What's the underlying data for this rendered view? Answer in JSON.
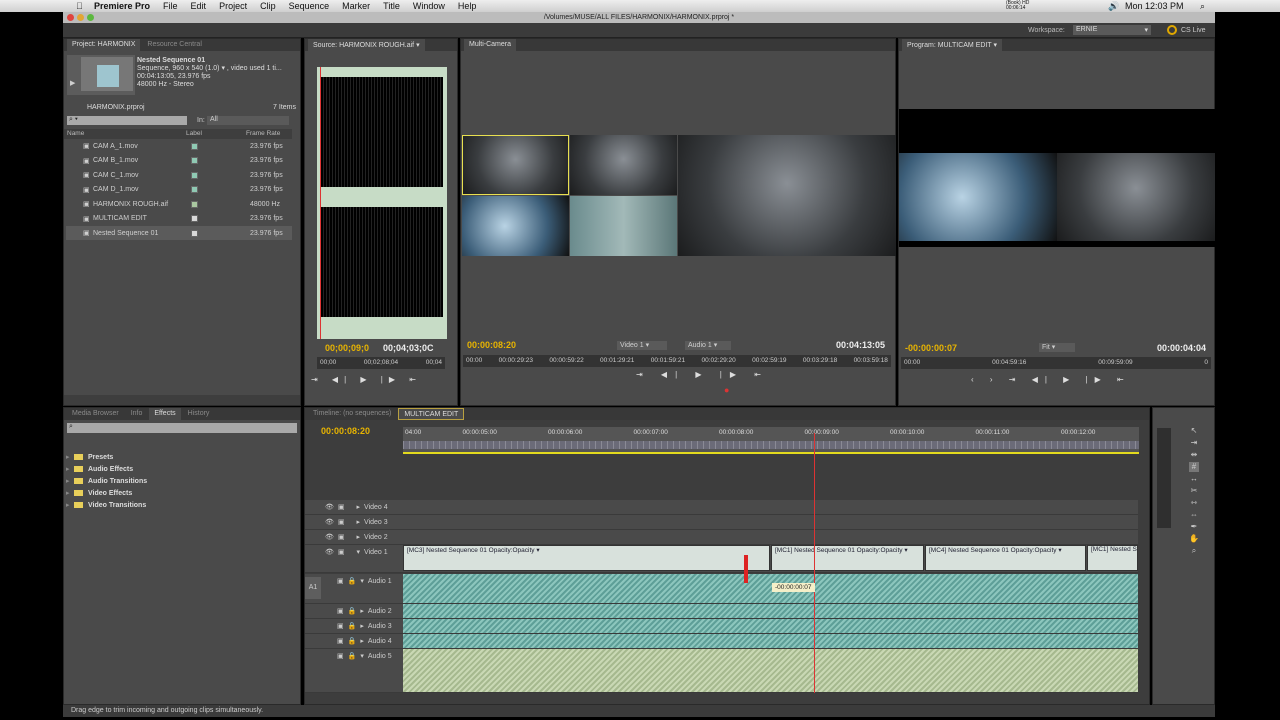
{
  "menubar": {
    "app": "Premiere Pro",
    "items": [
      "File",
      "Edit",
      "Project",
      "Clip",
      "Sequence",
      "Marker",
      "Title",
      "Window",
      "Help"
    ],
    "clock": "Mon 12:03 PM",
    "status_text": "(Book) HD 00:06:14"
  },
  "window": {
    "title": "/Volumes/MUSE/ALL FILES/HARMONIX/HARMONIX.prproj *"
  },
  "workspace": {
    "label": "Workspace:",
    "value": "ERNIE",
    "cs_live": "CS Live"
  },
  "project": {
    "tabs": [
      "Project: HARMONIX",
      "Resource Central"
    ],
    "preview": {
      "name": "Nested Sequence 01",
      "line1": "Sequence, 960 x 540 (1.0) ▾ , video used 1 ti...",
      "line2": "00:04:13:05, 23.976 fps",
      "line3": "48000 Hz - Stereo"
    },
    "file": "HARMONIX.prproj",
    "count": "7 Items",
    "search_placeholder": "",
    "in_label": "In:",
    "in_value": "All",
    "columns": [
      "Name",
      "Label",
      "Frame Rate"
    ],
    "items": [
      {
        "name": "CAM A_1.mov",
        "rate": "23.976 fps",
        "color": "#8fc9b3"
      },
      {
        "name": "CAM B_1.mov",
        "rate": "23.976 fps",
        "color": "#8fc9b3"
      },
      {
        "name": "CAM C_1.mov",
        "rate": "23.976 fps",
        "color": "#8fc9b3"
      },
      {
        "name": "CAM D_1.mov",
        "rate": "23.976 fps",
        "color": "#8fc9b3"
      },
      {
        "name": "HARMONIX ROUGH.aif",
        "rate": "48000 Hz",
        "color": "#a9c7a0"
      },
      {
        "name": "MULTICAM EDIT",
        "rate": "23.976 fps",
        "color": "#d9d9d9"
      },
      {
        "name": "Nested Sequence 01",
        "rate": "23.976 fps",
        "color": "#d9d9d9"
      }
    ]
  },
  "source": {
    "tab": "Source: HARMONIX ROUGH.aif",
    "tc": "00;00;09;0",
    "duration": "00;04;03;0C",
    "ruler": [
      "00;00",
      "00;02;08;04",
      "00;04"
    ]
  },
  "multicam": {
    "tab": "Multi-Camera",
    "tc": "00:00:08:20",
    "video_sel": "Video 1",
    "audio_sel": "Audio 1",
    "duration": "00:04:13:05",
    "ruler": [
      "00:00",
      "00:00:29:23",
      "00:00:59:22",
      "00:01:29:21",
      "00:01:59:21",
      "00:02:29:20",
      "00:02:59:19",
      "00:03:29:18",
      "00:03:59:18"
    ]
  },
  "program": {
    "tab": "Program: MULTICAM EDIT",
    "tc": "-00:00:00:07",
    "fit": "Fit",
    "duration": "00:00:04:04",
    "ruler": [
      "00:00",
      "00:04:59:16",
      "00:09:59:09",
      "0"
    ]
  },
  "effects": {
    "tabs": [
      "Media Browser",
      "Info",
      "Effects",
      "History"
    ],
    "folders": [
      "Presets",
      "Audio Effects",
      "Audio Transitions",
      "Video Effects",
      "Video Transitions"
    ]
  },
  "timeline": {
    "tabs": [
      "Timeline: (no sequences)",
      "MULTICAM EDIT"
    ],
    "tc": "00:00:08:20",
    "ruler": [
      "04:00",
      "00:00:05:00",
      "00:00:06:00",
      "00:00:07:00",
      "00:00:08:00",
      "00:00:09:00",
      "00:00:10:00",
      "00:00:11:00",
      "00:00:12:00"
    ],
    "video_tracks": [
      "Video 4",
      "Video 3",
      "Video 2",
      "Video 1"
    ],
    "audio_tracks": [
      "Audio 1",
      "Audio 2",
      "Audio 3",
      "Audio 4",
      "Audio 5"
    ],
    "a1": "A1",
    "clips": [
      "[MC3] Nested Sequence 01  Opacity:Opacity ▾",
      "[MC1] Nested Sequence 01  Opacity:Opacity ▾",
      "[MC4] Nested Sequence 01  Opacity:Opacity ▾",
      "[MC1] Nested S"
    ],
    "trim_tooltip": "-00:00:00:07"
  },
  "status": "Drag edge to trim incoming and outgoing clips simultaneously."
}
